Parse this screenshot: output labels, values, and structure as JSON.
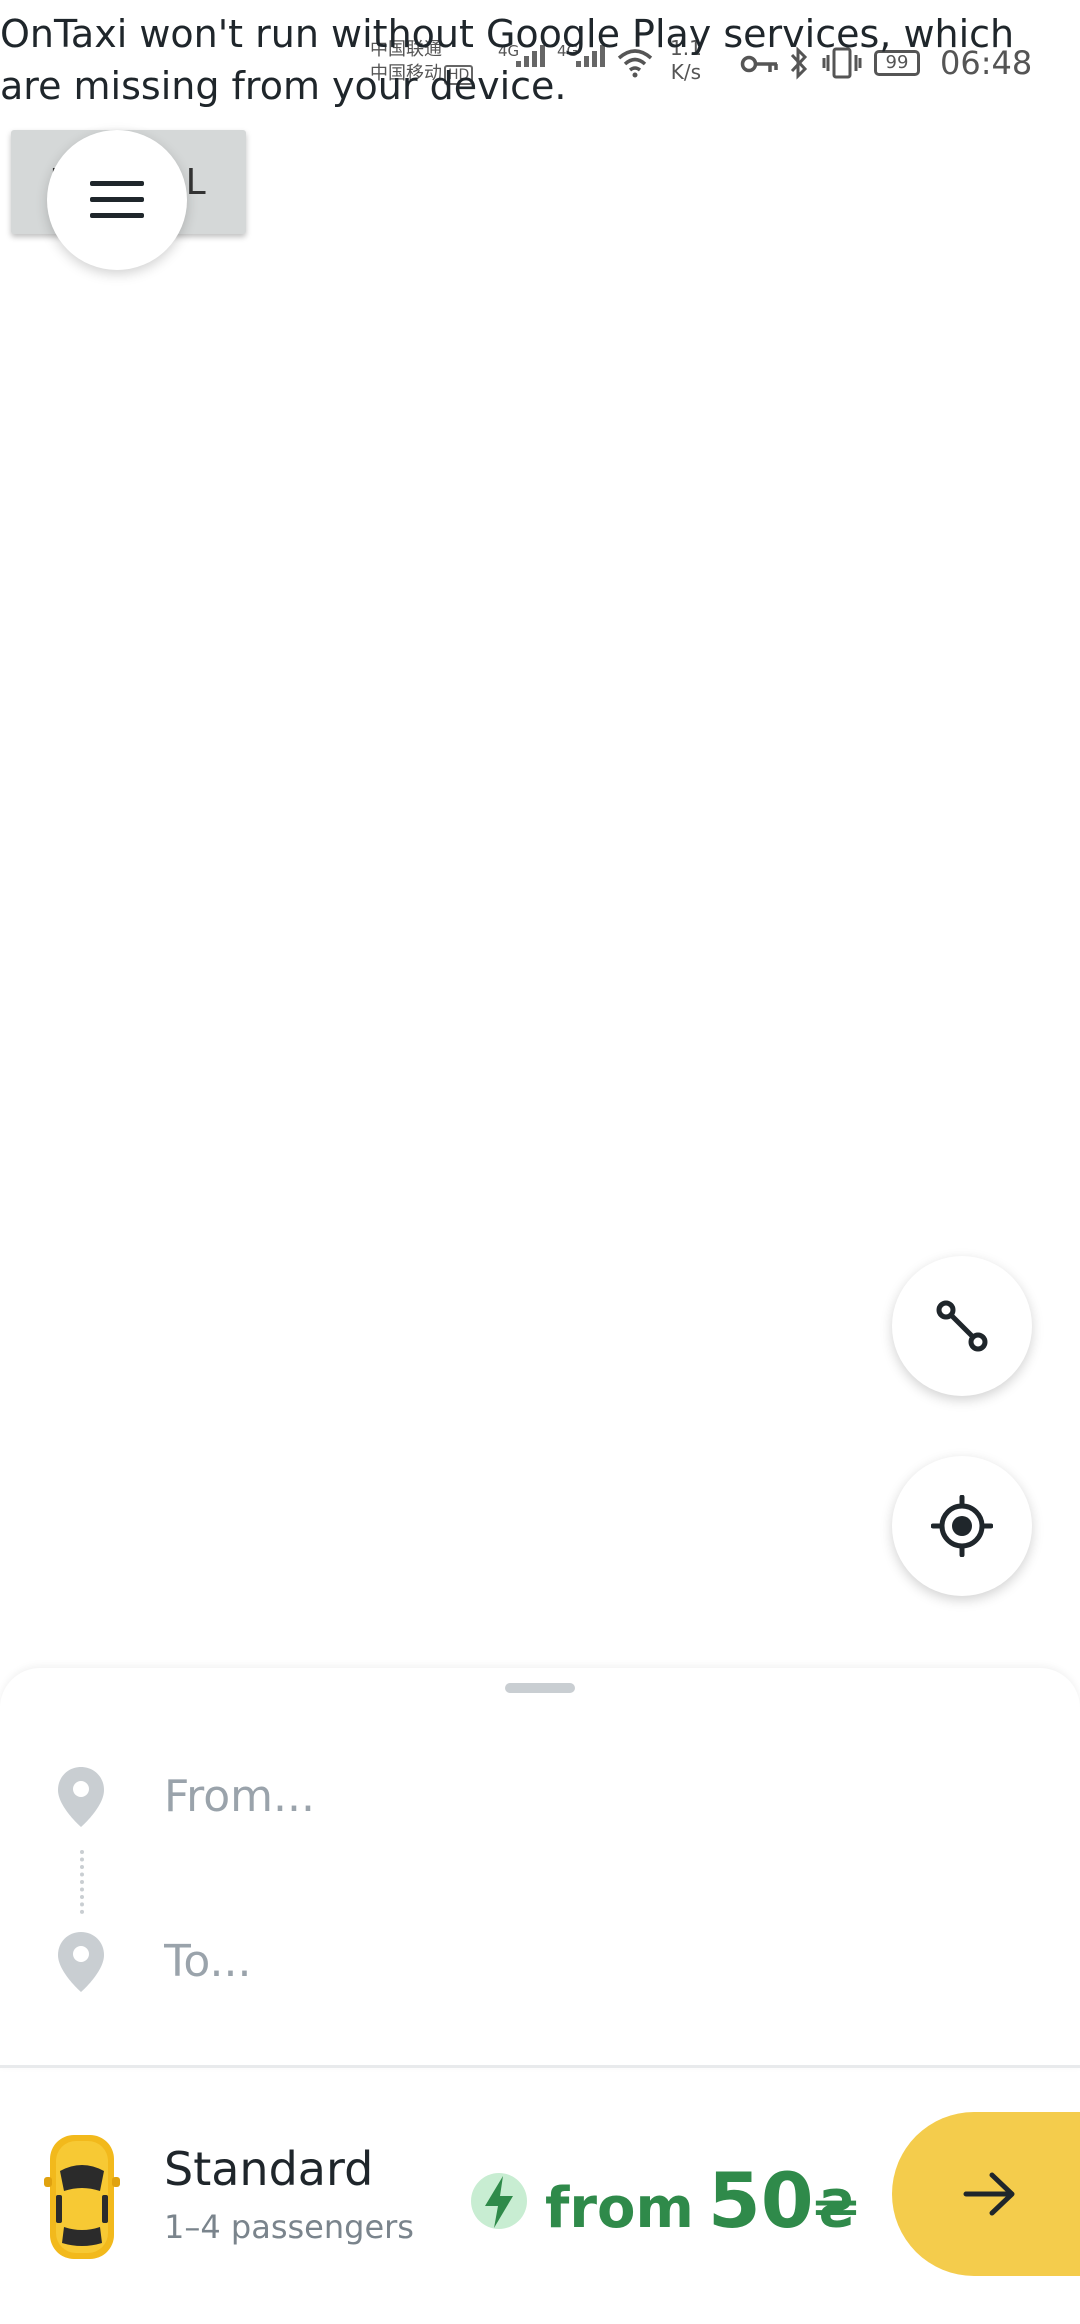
{
  "status_bar": {
    "carrier_1": "中国联通",
    "carrier_2": "中国移动",
    "hd": "HD",
    "net_1": "4G",
    "net_2": "4G",
    "speed_value": "1.1",
    "speed_unit": "K/s",
    "battery": "99",
    "time": "06:48"
  },
  "gms_error": {
    "message": "OnTaxi won't run without Google Play services, which are missing from your device.",
    "install_button_label": "INSTALL"
  },
  "search": {
    "from_placeholder": "From...",
    "to_placeholder": "To..."
  },
  "tariff": {
    "name": "Standard",
    "passengers": "1–4 passengers",
    "price_prefix": "from",
    "price_value": "50",
    "currency": "₴",
    "price_color": "#2f8a4a",
    "accent_color": "#f4cc4c"
  },
  "icons": [
    "menu-icon",
    "route-icon",
    "my-location-icon",
    "location-pin-icon",
    "car-icon",
    "lightning-icon",
    "arrow-right-icon"
  ]
}
